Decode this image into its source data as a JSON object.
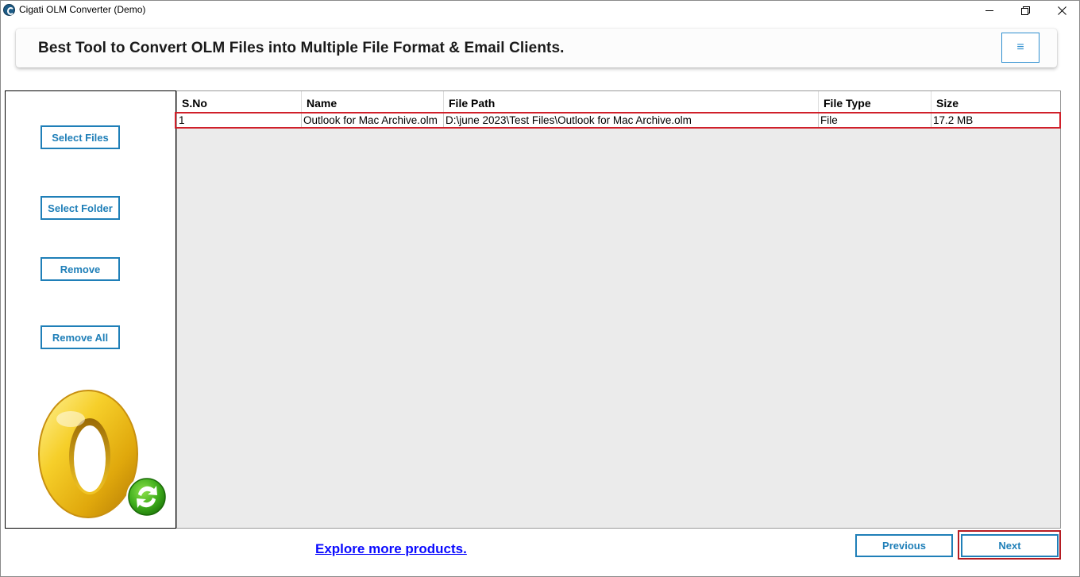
{
  "window": {
    "title": "Cigati OLM Converter (Demo)",
    "controls": [
      "minimize-icon",
      "restore-icon",
      "close-icon"
    ]
  },
  "banner": {
    "title": "Best Tool to Convert OLM Files into Multiple File Format & Email Clients.",
    "menu_icon": "≡"
  },
  "sidebar": {
    "select_files": "Select Files",
    "select_folder": "Select Folder",
    "remove": "Remove",
    "remove_all": "Remove All",
    "logo_icon": "outlook-mac-sync-logo"
  },
  "table": {
    "columns": [
      "S.No",
      "Name",
      "File Path",
      "File Type",
      "Size"
    ],
    "rows": [
      {
        "sno": "1",
        "name": "Outlook for Mac Archive.olm",
        "path": "D:\\june 2023\\Test Files\\Outlook for Mac Archive.olm",
        "type": "File",
        "size": "17.2 MB"
      }
    ]
  },
  "footer": {
    "explore": "Explore more products.",
    "previous": "Previous",
    "next": "Next"
  },
  "colors": {
    "accent": "#1f7fb8",
    "highlight": "#d0202a",
    "link": "#0a0aff"
  }
}
